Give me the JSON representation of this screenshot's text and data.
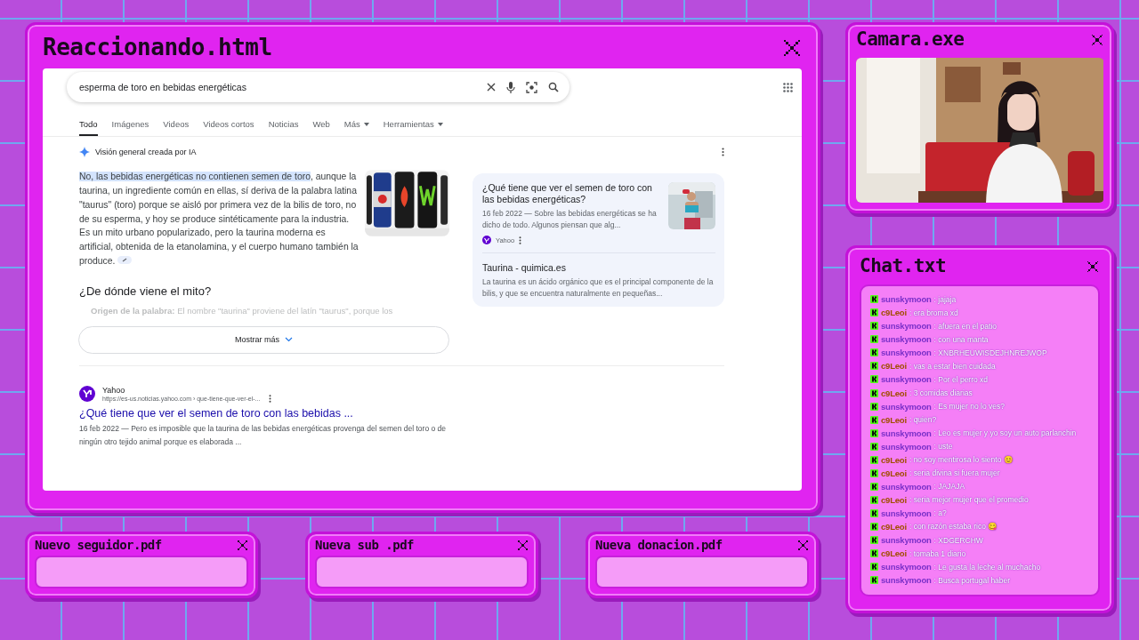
{
  "main_window": {
    "title": "Reaccionando.html"
  },
  "browser": {
    "search": {
      "value": "esperma de toro en bebidas energéticas"
    },
    "tabs": [
      {
        "label": "Todo",
        "selected": true,
        "dropdown": false
      },
      {
        "label": "Imágenes",
        "selected": false,
        "dropdown": false
      },
      {
        "label": "Videos",
        "selected": false,
        "dropdown": false
      },
      {
        "label": "Videos cortos",
        "selected": false,
        "dropdown": false
      },
      {
        "label": "Noticias",
        "selected": false,
        "dropdown": false
      },
      {
        "label": "Web",
        "selected": false,
        "dropdown": false
      },
      {
        "label": "Más",
        "selected": false,
        "dropdown": true
      },
      {
        "label": "Herramientas",
        "selected": false,
        "dropdown": true
      }
    ],
    "ai_overview": {
      "label": "Visión general creada por IA",
      "highlight": "No, las bebidas energéticas no contienen semen de toro",
      "text": ", aunque la taurina, un ingrediente común en ellas, sí deriva de la palabra latina \"taurus\" (toro) porque se aisló por primera vez de la bilis de toro, no de su esperma, y hoy se produce sintéticamente para la industria. Es un mito urbano popularizado, pero la taurina moderna es artificial, obtenida de la etanolamina, y el cuerpo humano también la produce.",
      "heading": "¿De dónde viene el mito?",
      "bullet": "**Origen de la palabra:** El nombre \"taurina\" proviene del latín \"taurus\", porque los",
      "show_more": "Mostrar más",
      "sources": [
        {
          "title": "¿Qué tiene que ver el semen de toro con las bebidas energéticas?",
          "snippet": "16 feb 2022 — Sobre las bebidas energéticas se ha dicho de todo. Algunos piensan que alg...",
          "site": "Yahoo",
          "thumbnail": true
        },
        {
          "title": "Taurina - quimica.es",
          "snippet": "La taurina es un ácido orgánico que es el principal componente de la bilis, y que se encuentra naturalmente en pequeñas...",
          "thumbnail": false
        }
      ]
    },
    "result": {
      "site": "Yahoo",
      "url": "https://es-us.noticias.yahoo.com › que-tiene-que-ver-el-...",
      "title": "¿Qué tiene que ver el semen de toro con las bebidas ...",
      "snippet": "16 feb 2022 — Pero es imposible que la taurina de las bebidas energéticas provenga del semen del toro o de ningún otro tejido animal porque es elaborada ..."
    }
  },
  "camera": {
    "title": "Camara.exe"
  },
  "chat": {
    "title": "Chat.txt",
    "messages": [
      {
        "user": "sunskymoon",
        "text": ": jajaja",
        "color": "#7a30c8"
      },
      {
        "user": "c9Leoi",
        "text": ": era broma xd",
        "color": "#a04e00"
      },
      {
        "user": "sunskymoon",
        "text": ": afuera en el patio",
        "color": "#7a30c8"
      },
      {
        "user": "sunskymoon",
        "text": ": con una manta",
        "color": "#7a30c8"
      },
      {
        "user": "sunskymoon",
        "text": ": XNBRHEUWISDEJHNREJWOP",
        "color": "#7a30c8"
      },
      {
        "user": "c9Leoi",
        "text": ": vas a estar bien cuidada",
        "color": "#a04e00"
      },
      {
        "user": "sunskymoon",
        "text": ": Por el perro xd",
        "color": "#7a30c8"
      },
      {
        "user": "c9Leoi",
        "text": ": 3 comidas diarias",
        "color": "#a04e00"
      },
      {
        "user": "sunskymoon",
        "text": ": Es mujer no lo ves?",
        "color": "#7a30c8"
      },
      {
        "user": "c9Leoi",
        "text": ": quien?",
        "color": "#a04e00"
      },
      {
        "user": "sunskymoon",
        "text": ": Leo es mujer y yo soy un auto parlanchin",
        "color": "#7a30c8"
      },
      {
        "user": "sunskymoon",
        "text": ": uste",
        "color": "#7a30c8"
      },
      {
        "user": "c9Leoi",
        "text": ": no soy mentirosa lo siento 😊",
        "color": "#a04e00"
      },
      {
        "user": "c9Leoi",
        "text": ": seria divina si fuera mujer",
        "color": "#a04e00"
      },
      {
        "user": "sunskymoon",
        "text": ": JAJAJA",
        "color": "#7a30c8"
      },
      {
        "user": "c9Leoi",
        "text": ": seria mejor mujer que el promedio",
        "color": "#a04e00"
      },
      {
        "user": "sunskymoon",
        "text": ": a?",
        "color": "#7a30c8"
      },
      {
        "user": "c9Leoi",
        "text": ": con razón estaba rico 😋",
        "color": "#a04e00"
      },
      {
        "user": "sunskymoon",
        "text": ": XDGERCHW",
        "color": "#7a30c8"
      },
      {
        "user": "c9Leoi",
        "text": ": tomaba 1 diario",
        "color": "#a04e00"
      },
      {
        "user": "sunskymoon",
        "text": ": Le gusta la leche al muchacho",
        "color": "#7a30c8"
      },
      {
        "user": "sunskymoon",
        "text": ": Busca portugal haber",
        "color": "#7a30c8"
      }
    ]
  },
  "alerts": [
    {
      "title": "Nuevo seguidor.pdf"
    },
    {
      "title": "Nueva sub .pdf"
    },
    {
      "title": "Nueva donacion.pdf"
    }
  ]
}
